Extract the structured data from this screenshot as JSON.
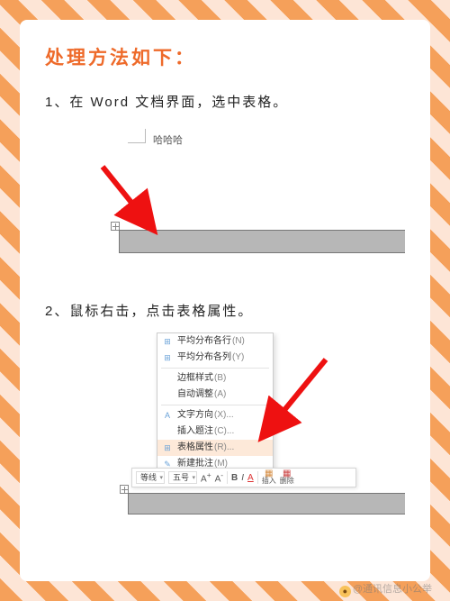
{
  "title": "处理方法如下：",
  "steps": {
    "s1": "1、在 Word 文档界面，选中表格。",
    "s2": "2、鼠标右击，点击表格属性。"
  },
  "shot1": {
    "placeholder_text": "哈哈哈"
  },
  "context_menu": {
    "items": [
      {
        "icon": "⊞",
        "label": "平均分布各行",
        "shortcut": "(N)"
      },
      {
        "icon": "⊞",
        "label": "平均分布各列",
        "shortcut": "(Y)"
      },
      {
        "icon": "",
        "label": "边框样式",
        "shortcut": "(B)"
      },
      {
        "icon": "",
        "label": "自动调整",
        "shortcut": "(A)"
      },
      {
        "icon": "A",
        "label": "文字方向",
        "shortcut": "(X)..."
      },
      {
        "icon": "",
        "label": "插入题注",
        "shortcut": "(C)..."
      },
      {
        "icon": "⊞",
        "label": "表格属性",
        "shortcut": "(R)...",
        "hl": true
      },
      {
        "icon": "✎",
        "label": "新建批注",
        "shortcut": "(M)"
      }
    ]
  },
  "mini_toolbar": {
    "font_style": "等线",
    "font_size": "五号",
    "bold": "B",
    "italic": "I",
    "font_a": "A",
    "insert_label": "插入",
    "delete_label": "删除"
  },
  "watermark": {
    "text": "@通讯信息小公举"
  }
}
